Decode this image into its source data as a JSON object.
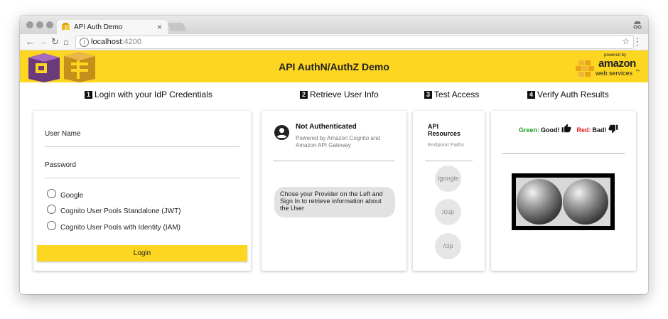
{
  "browser": {
    "tab_title": "API Auth Demo",
    "tab_close": "×",
    "address_host": "localhost",
    "address_port": ":4200",
    "nav": {
      "back": "←",
      "forward": "→",
      "reload": "↻",
      "home": "⌂",
      "star": "☆",
      "menu": "⋮",
      "info": "i"
    }
  },
  "header": {
    "title": "API AuthN/AuthZ Demo",
    "aws_powered_by": "powered by",
    "aws_name": "amazon",
    "aws_sub": "web services",
    "aws_tm": "™"
  },
  "steps": [
    {
      "num": "1",
      "label": "Login with your IdP Credentials"
    },
    {
      "num": "2",
      "label": "Retrieve User Info"
    },
    {
      "num": "3",
      "label": "Test Access"
    },
    {
      "num": "4",
      "label": "Verify Auth Results"
    }
  ],
  "login": {
    "username_label": "User Name",
    "password_label": "Password",
    "providers": [
      "Google",
      "Cognito User Pools Standalone (JWT)",
      "Cognito User Pools with Identity (IAM)"
    ],
    "button": "Login"
  },
  "userinfo": {
    "status": "Not Authenticated",
    "desc_line1": "Powered by Amazon Cognito and",
    "desc_line2": "Amazon API Gateway",
    "bubble_line1": "Chose your Provider on the Left and",
    "bubble_line2": "Sign In to retrieve information about",
    "bubble_line3": "the User"
  },
  "api": {
    "title_line1": "API",
    "title_line2": "Resources",
    "subtitle": "Endpoint Paths",
    "paths": [
      "/google",
      "/cup",
      "/cip"
    ]
  },
  "verify": {
    "green_label": "Green:",
    "good": "Good!",
    "red_label": "Red:",
    "bad": "Bad!"
  },
  "colors": {
    "accent": "#fdd621",
    "green": "#1e9e1e",
    "red": "#e02020"
  },
  "icons": [
    "aws-cube-logo",
    "thumbs-up-icon",
    "thumbs-down-icon",
    "account-circle-icon",
    "info-icon",
    "star-icon",
    "incognito-icon"
  ]
}
